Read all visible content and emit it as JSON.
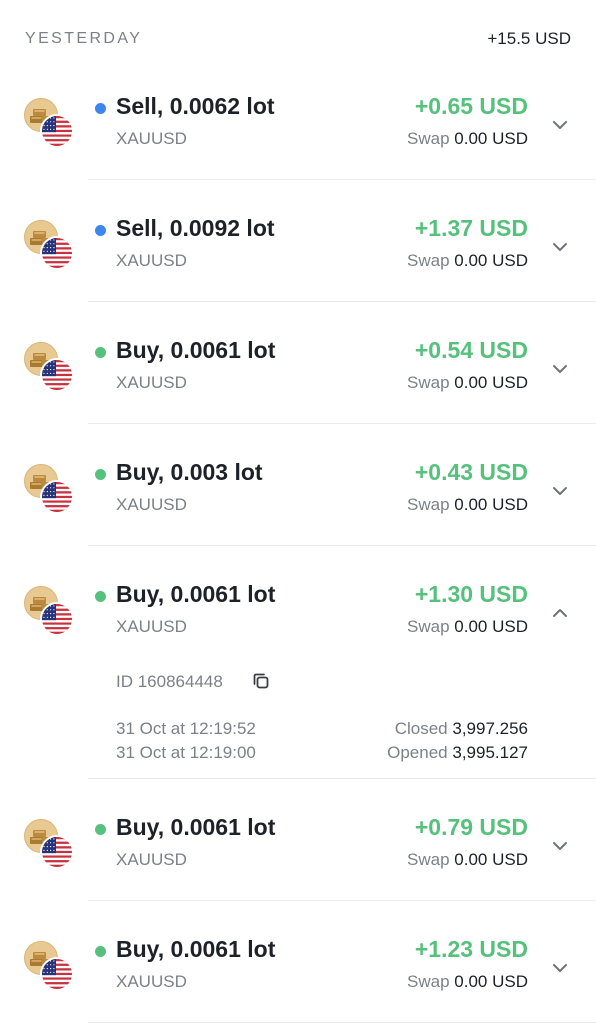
{
  "header": {
    "day_label": "YESTERDAY",
    "total": "+15.5 USD"
  },
  "swap_label": "Swap",
  "colors": {
    "sell_dot": "#3d86f0",
    "buy_dot": "#56c17c",
    "profit": "#56c17c"
  },
  "trades": [
    {
      "side": "sell",
      "title": "Sell, 0.0062 lot",
      "symbol": "XAUUSD",
      "pnl": "+0.65 USD",
      "swap": "0.00 USD",
      "expanded": false,
      "chevron": "chevron-down-icon"
    },
    {
      "side": "sell",
      "title": "Sell, 0.0092 lot",
      "symbol": "XAUUSD",
      "pnl": "+1.37 USD",
      "swap": "0.00 USD",
      "expanded": false,
      "chevron": "chevron-down-icon"
    },
    {
      "side": "buy",
      "title": "Buy, 0.0061 lot",
      "symbol": "XAUUSD",
      "pnl": "+0.54 USD",
      "swap": "0.00 USD",
      "expanded": false,
      "chevron": "chevron-down-icon"
    },
    {
      "side": "buy",
      "title": "Buy, 0.003 lot",
      "symbol": "XAUUSD",
      "pnl": "+0.43 USD",
      "swap": "0.00 USD",
      "expanded": false,
      "chevron": "chevron-down-icon"
    },
    {
      "side": "buy",
      "title": "Buy, 0.0061 lot",
      "symbol": "XAUUSD",
      "pnl": "+1.30 USD",
      "swap": "0.00 USD",
      "expanded": true,
      "chevron": "chevron-up-icon",
      "details": {
        "id_text": "ID 160864448",
        "closed_time": "31 Oct at 12:19:52",
        "opened_time": "31 Oct at 12:19:00",
        "closed_label": "Closed",
        "closed_price": "3,997.256",
        "opened_label": "Opened",
        "opened_price": "3,995.127"
      }
    },
    {
      "side": "buy",
      "title": "Buy, 0.0061 lot",
      "symbol": "XAUUSD",
      "pnl": "+0.79 USD",
      "swap": "0.00 USD",
      "expanded": false,
      "chevron": "chevron-down-icon"
    },
    {
      "side": "buy",
      "title": "Buy, 0.0061 lot",
      "symbol": "XAUUSD",
      "pnl": "+1.23 USD",
      "swap": "0.00 USD",
      "expanded": false,
      "chevron": "chevron-down-icon"
    }
  ]
}
